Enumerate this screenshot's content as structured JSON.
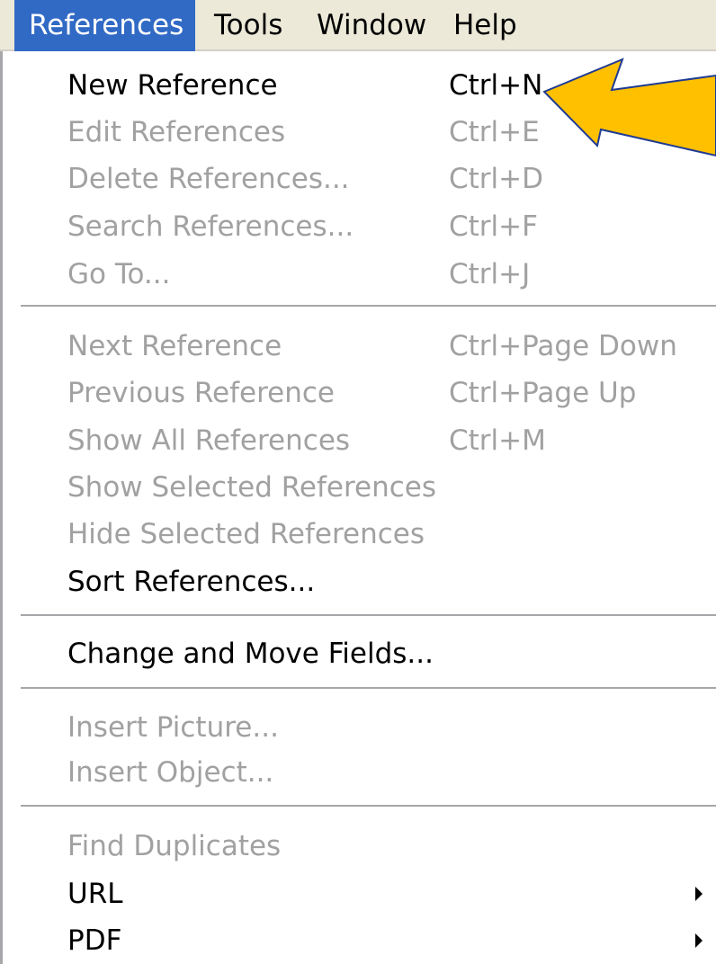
{
  "menubar": {
    "items": [
      {
        "label": "References",
        "active": true
      },
      {
        "label": "Tools",
        "active": false
      },
      {
        "label": "Window",
        "active": false
      },
      {
        "label": "Help",
        "active": false
      }
    ]
  },
  "dropdown": {
    "items": [
      {
        "label": "New Reference",
        "shortcut": "Ctrl+N",
        "enabled": true
      },
      {
        "label": "Edit References",
        "shortcut": "Ctrl+E",
        "enabled": false
      },
      {
        "label": "Delete References...",
        "shortcut": "Ctrl+D",
        "enabled": false
      },
      {
        "label": "Search References...",
        "shortcut": "Ctrl+F",
        "enabled": false
      },
      {
        "label": "Go To...",
        "shortcut": "Ctrl+J",
        "enabled": false
      },
      {
        "label": "Next Reference",
        "shortcut": "Ctrl+Page Down",
        "enabled": false
      },
      {
        "label": "Previous Reference",
        "shortcut": "Ctrl+Page Up",
        "enabled": false
      },
      {
        "label": "Show All References",
        "shortcut": "Ctrl+M",
        "enabled": false
      },
      {
        "label": "Show Selected References",
        "shortcut": "",
        "enabled": false
      },
      {
        "label": "Hide Selected References",
        "shortcut": "",
        "enabled": false
      },
      {
        "label": "Sort References...",
        "shortcut": "",
        "enabled": true
      },
      {
        "label": "Change and Move Fields...",
        "shortcut": "",
        "enabled": true
      },
      {
        "label": "Insert Picture...",
        "shortcut": "",
        "enabled": false
      },
      {
        "label": "Insert Object...",
        "shortcut": "",
        "enabled": false
      },
      {
        "label": "Find Duplicates",
        "shortcut": "",
        "enabled": false
      },
      {
        "label": "URL",
        "shortcut": "",
        "enabled": true,
        "submenu": true
      },
      {
        "label": "PDF",
        "shortcut": "",
        "enabled": true,
        "submenu": true
      }
    ]
  },
  "annotation": {
    "type": "callout-arrow",
    "color": "#ffc000",
    "outline": "#1f3a93",
    "target": "New Reference"
  },
  "colors": {
    "menubar_bg": "#ece9d8",
    "highlight": "#316ac5",
    "disabled_text": "#a1a1a1",
    "enabled_text": "#000000"
  }
}
